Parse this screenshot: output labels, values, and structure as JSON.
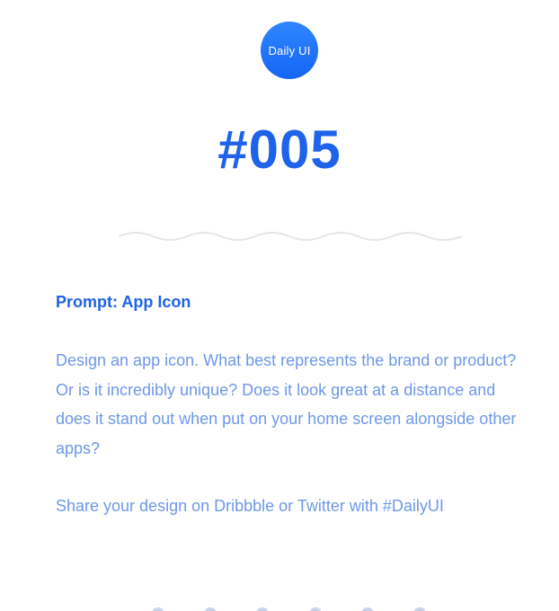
{
  "logo": {
    "text": "Daily UI",
    "gradient_top": "#2f86ff",
    "gradient_bottom": "#1565f5"
  },
  "issue_number": "#005",
  "prompt": {
    "title": "Prompt: App Icon",
    "body": "Design an app icon. What best represents the brand or product? Or is it incredibly unique? Does it look great at a distance and does it stand out when put on your home screen alongside other apps?",
    "share": "Share your design on Dribbble or Twitter with #DailyUI"
  },
  "social_icons": [
    "social-icon",
    "social-icon",
    "social-icon",
    "social-icon",
    "social-icon",
    "social-icon"
  ],
  "colors": {
    "accent": "#1e63e9",
    "body_text": "#6e98e8",
    "divider": "#e6e6e6",
    "background": "#ffffff"
  }
}
